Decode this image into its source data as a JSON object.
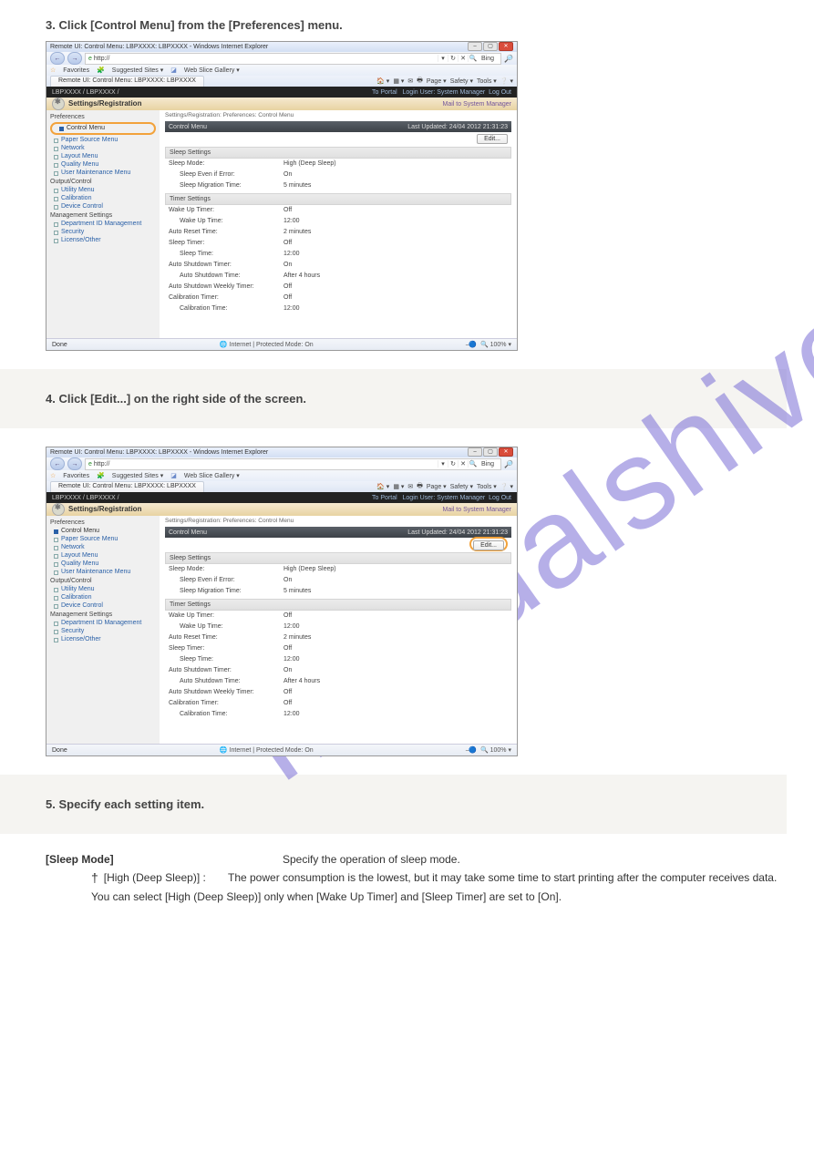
{
  "browser": {
    "title": "Remote UI: Control Menu: LBPXXXX: LBPXXXX - Windows Internet Explorer",
    "window_buttons": {
      "min": "–",
      "max": "▢",
      "close": "✕"
    },
    "nav": {
      "back": "←",
      "fwd": "→",
      "url_icon": "e",
      "url": "http://",
      "refresh": "↻",
      "stop": "✕",
      "search_icon": "🔍",
      "search_engine": "Bing",
      "go": "→",
      "mag": "🔎"
    },
    "fav_row": {
      "star": "☆",
      "label": "Favorites",
      "sug": "Suggested Sites ▾",
      "slice": "Web Slice Gallery ▾",
      "sug_icon": "🧩",
      "slice_icon": "◪"
    },
    "tab": "Remote UI: Control Menu: LBPXXXX: LBPXXXX",
    "toolbar": {
      "home": "🏠 ▾",
      "feed": "▦ ▾",
      "mail": "✉",
      "print": "🖶",
      "page": "Page ▾",
      "safety": "Safety ▾",
      "tools": "Tools ▾",
      "help": "❔ ▾"
    },
    "status": {
      "left": "Done",
      "mid": "🌐 Internet | Protected Mode: On",
      "zoom_icon": "🔍",
      "zoom": "100%  ▾",
      "slider": "⎯🔵"
    }
  },
  "app": {
    "breadcrumb_bar": "LBPXXXX / LBPXXXX /",
    "top_links": {
      "portal": "To Portal",
      "login": "Login User:",
      "user": "System Manager",
      "logout": "Log Out"
    },
    "sr_title": "Settings/Registration",
    "mail_link": "Mail to System Manager",
    "crumb": "Settings/Registration: Preferences: Control Menu",
    "panel_title": "Control Menu",
    "panel_updated": "Last Updated: 24/04 2012 21:31:23",
    "edit": "Edit...",
    "side": {
      "cat1": "Preferences",
      "m_control": "Control Menu",
      "m_paper": "Paper Source Menu",
      "m_network": "Network",
      "m_layout": "Layout Menu",
      "m_quality": "Quality Menu",
      "m_umaint": "User Maintenance Menu",
      "cat2": "Output/Control",
      "m_utility": "Utility Menu",
      "m_calib": "Calibration",
      "m_device": "Device Control",
      "cat3": "Management Settings",
      "m_dept": "Department ID Management",
      "m_security": "Security",
      "m_license": "License/Other"
    },
    "sleep": {
      "hdr": "Sleep Settings",
      "mode_k": "Sleep Mode:",
      "mode_v": "High (Deep Sleep)",
      "err_k": "Sleep Even if Error:",
      "err_v": "On",
      "mig_k": "Sleep Migration Time:",
      "mig_v": "5 minutes"
    },
    "timer": {
      "hdr": "Timer Settings",
      "wut_k": "Wake Up Timer:",
      "wut_v": "Off",
      "wut2_k": "Wake Up Time:",
      "wut2_v": "12:00",
      "art_k": "Auto Reset Time:",
      "art_v": "2 minutes",
      "st_k": "Sleep Timer:",
      "st_v": "Off",
      "st2_k": "Sleep Time:",
      "st2_v": "12:00",
      "ast_k": "Auto Shutdown Timer:",
      "ast_v": "On",
      "ast2_k": "Auto Shutdown Time:",
      "ast2_v": "After 4 hours",
      "asw_k": "Auto Shutdown Weekly Timer:",
      "asw_v": "Off",
      "cal_k": "Calibration Timer:",
      "cal_v": "Off",
      "cal2_k": "Calibration Time:",
      "cal2_v": "12:00"
    }
  },
  "txt": {
    "step3": "3. Click [Control Menu] from the [Preferences] menu.",
    "step4": "4. Click [Edit...] on the right side of the screen.",
    "step5": "5. Specify each setting item.",
    "opt1_k": "[Sleep Mode]",
    "opt1_v": "Specify the operation of sleep mode.",
    "opt2_k": "[High (Deep Sleep)]  :",
    "opt2_v": "The power consumption is the lowest, but it may take some time to start printing after the computer receives data.",
    "note": "You can select [High (Deep Sleep)] only when [Wake Up Timer] and [Sleep Timer] are set to [On]."
  }
}
